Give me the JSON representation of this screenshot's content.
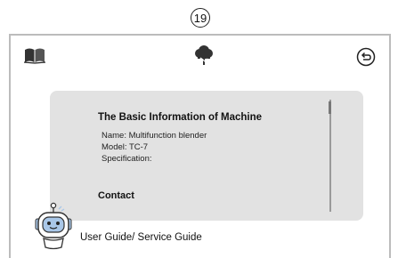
{
  "page_number": "19",
  "header": {
    "left_icon": "book-icon",
    "center_icon": "cloud-tree-icon",
    "right_icon": "back-arrow-icon"
  },
  "info_panel": {
    "title": "The Basic Information of Machine",
    "name_line": "Name: Multifunction blender",
    "model_line": "Model: TC-7",
    "specification_line": "Specification:",
    "contact_label": "Contact"
  },
  "assistant": {
    "icon": "robot-avatar",
    "label": "User Guide/ Service Guide"
  },
  "colors": {
    "panel_background": "#e2e2e2",
    "frame_border": "#bcbcbc",
    "robot_accent": "#a9c7e8"
  }
}
